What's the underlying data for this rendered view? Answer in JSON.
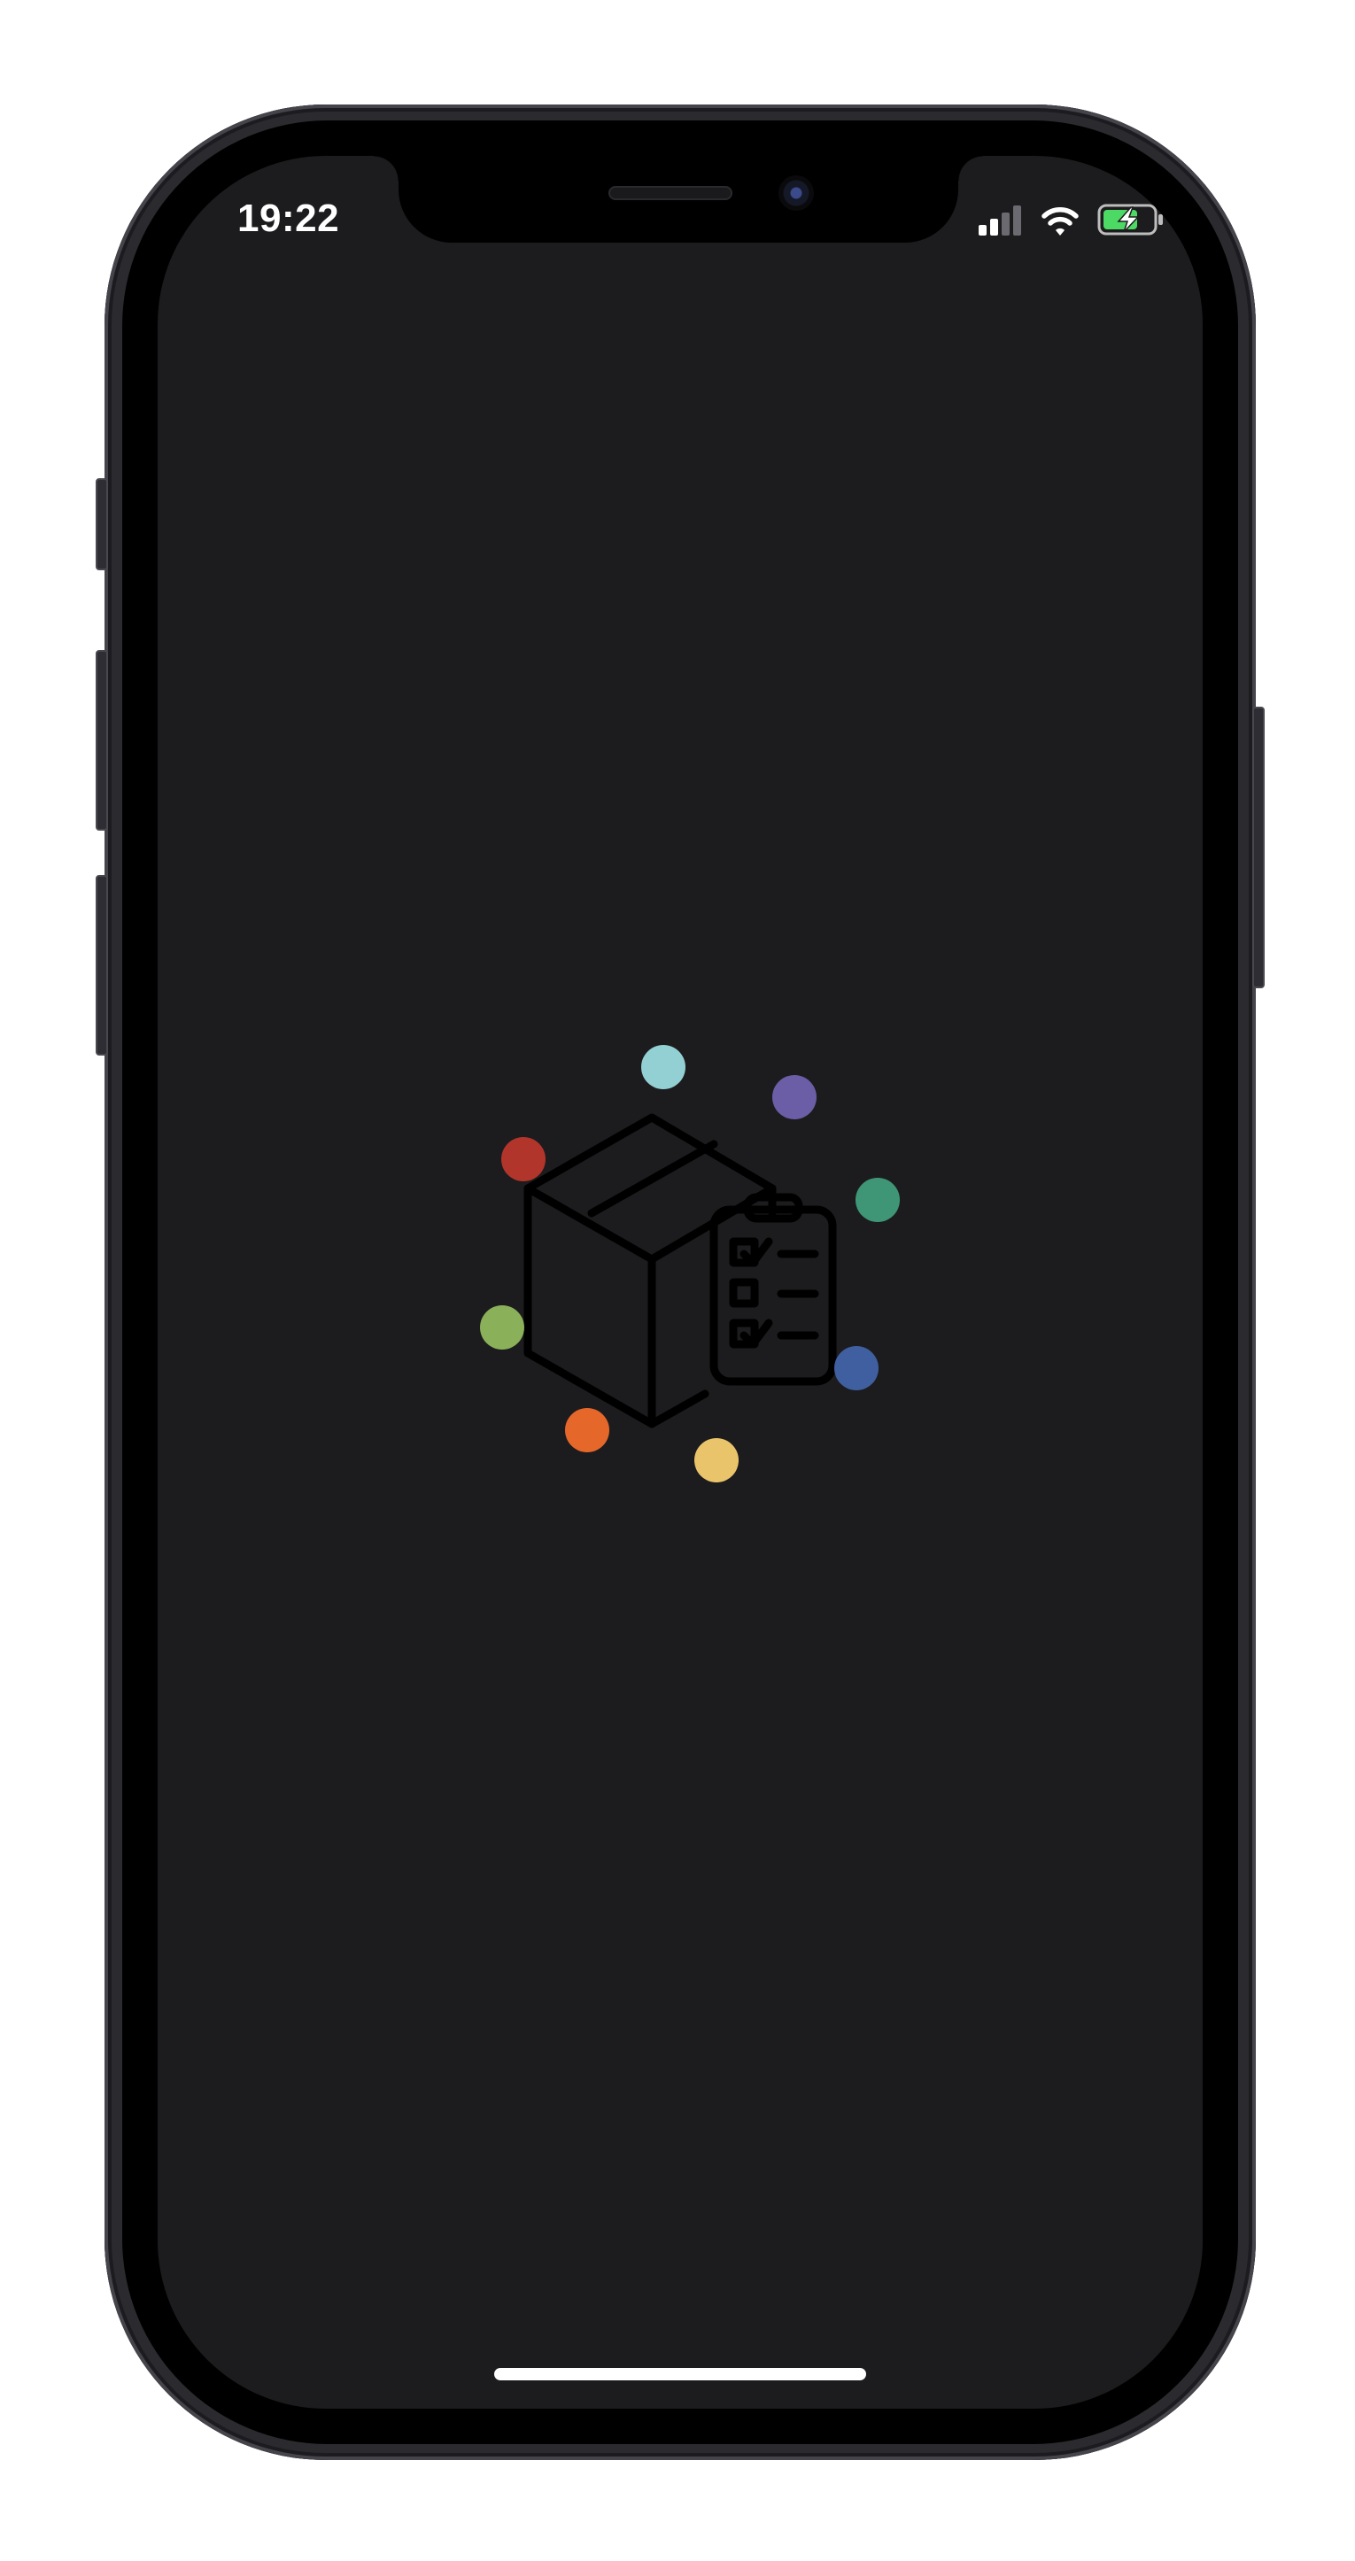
{
  "status_bar": {
    "time": "19:22",
    "signal_icon": "cellular-signal-icon",
    "wifi_icon": "wifi-icon",
    "battery_icon": "battery-charging-icon"
  },
  "splash": {
    "logo_icon": "package-checklist-icon",
    "dot_colors": [
      "#93d0d3",
      "#6b5ea6",
      "#b2352b",
      "#3f9676",
      "#8ab05a",
      "#3f5fa0",
      "#e6672a",
      "#eac46a"
    ]
  },
  "colors": {
    "screen_background": "#1c1c1e",
    "home_indicator": "#ffffff",
    "battery_fill": "#4cd964"
  }
}
